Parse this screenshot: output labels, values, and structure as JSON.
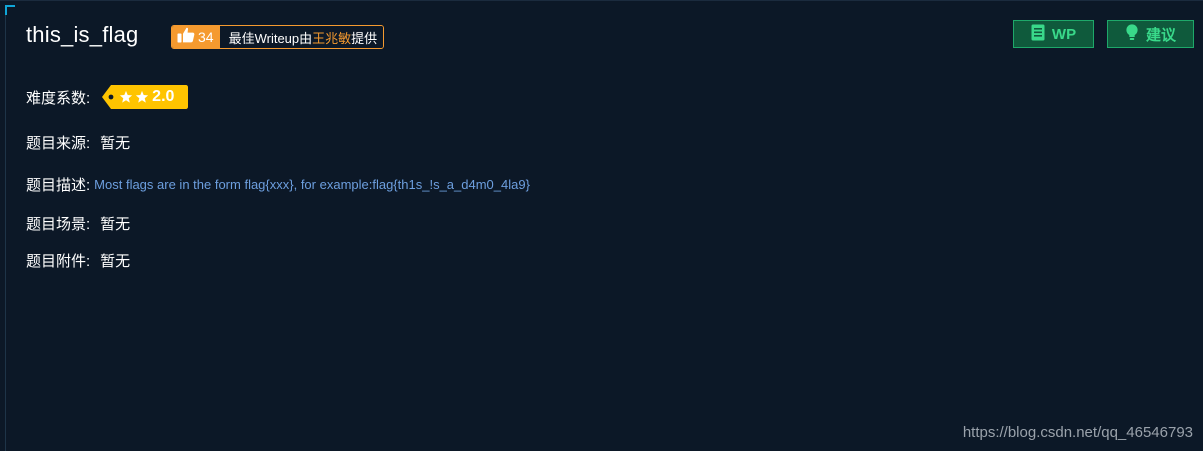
{
  "challenge": {
    "title": "this_is_flag",
    "likes": "34",
    "writeup_prefix": "最佳Writeup由",
    "writeup_author": "王兆敏",
    "writeup_suffix": "提供"
  },
  "buttons": {
    "wp_label": "WP",
    "suggest_label": "建议"
  },
  "fields": {
    "difficulty_label": "难度系数:",
    "difficulty_value": "2.0",
    "difficulty_stars": 2,
    "source_label": "题目来源:",
    "source_value": "暂无",
    "description_label": "题目描述:",
    "description_value": "Most flags are in the form flag{xxx}, for example:flag{th1s_!s_a_d4m0_4la9}",
    "scene_label": "题目场景:",
    "scene_value": "暂无",
    "attachment_label": "题目附件:",
    "attachment_value": "暂无"
  },
  "watermark": "https://blog.csdn.net/qq_46546793",
  "colors": {
    "background": "#0c1827",
    "accent_orange": "#f59a2f",
    "button_green": "#39d98a",
    "description_blue": "#6d9fdf",
    "star_yellow": "#ffc400"
  },
  "icons": {
    "like": "thumbs-up-icon",
    "wp": "document-icon",
    "suggest": "lightbulb-icon",
    "star": "star-icon"
  }
}
